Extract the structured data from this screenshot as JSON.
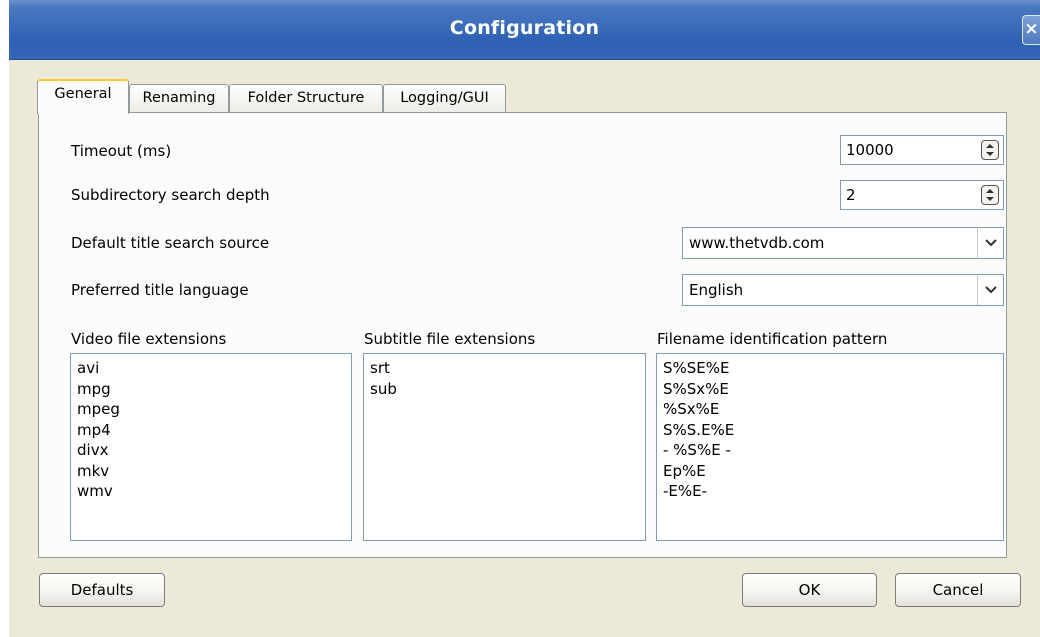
{
  "window": {
    "title": "Configuration",
    "close_glyph": "×"
  },
  "tabs": [
    {
      "label": "General",
      "active": true
    },
    {
      "label": "Renaming",
      "active": false
    },
    {
      "label": "Folder Structure",
      "active": false
    },
    {
      "label": "Logging/GUI",
      "active": false
    }
  ],
  "general": {
    "timeout": {
      "label": "Timeout (ms)",
      "value": "10000"
    },
    "subdir_depth": {
      "label": "Subdirectory search depth",
      "value": "2"
    },
    "title_source": {
      "label": "Default title search source",
      "value": "www.thetvdb.com"
    },
    "title_language": {
      "label": "Preferred title language",
      "value": "English"
    },
    "video_ext": {
      "label": "Video file extensions",
      "items": [
        "avi",
        "mpg",
        "mpeg",
        "mp4",
        "divx",
        "mkv",
        "wmv"
      ]
    },
    "subtitle_ext": {
      "label": "Subtitle file extensions",
      "items": [
        "srt",
        "sub"
      ]
    },
    "pattern": {
      "label": "Filename identification pattern",
      "items": [
        "S%SE%E",
        "S%Sx%E",
        "%Sx%E",
        "S%S.E%E",
        "- %S%E -",
        "Ep%E",
        "-E%E-"
      ]
    }
  },
  "buttons": {
    "defaults": "Defaults",
    "ok": "OK",
    "cancel": "Cancel"
  },
  "icons": {
    "close": "close-icon",
    "spinner": "spinner-icon",
    "dropdown": "chevron-down-icon"
  },
  "colors": {
    "titlebar": "#3a6cbb",
    "window_bg": "#ece9d8",
    "active_tab_accent": "#ffc83c",
    "input_border": "#7f9db9"
  }
}
